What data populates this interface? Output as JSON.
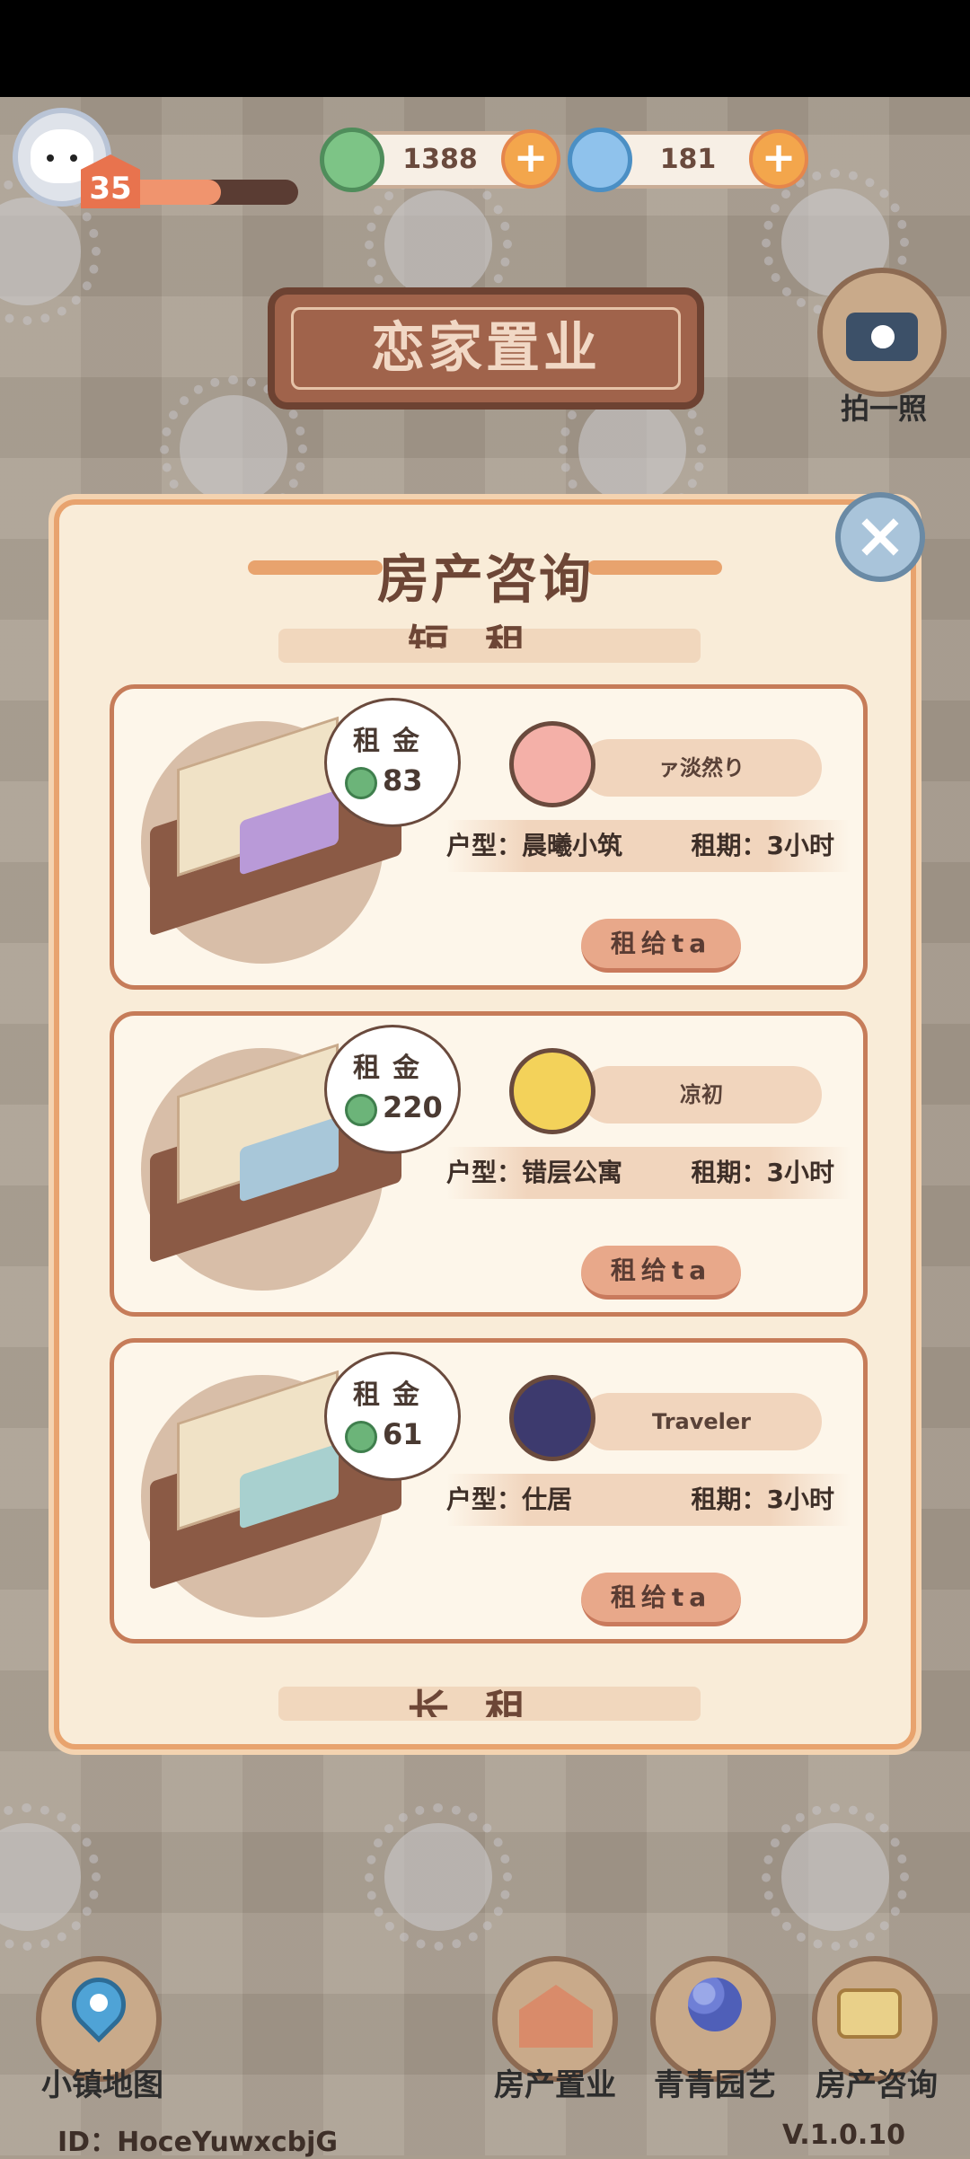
{
  "player": {
    "level": "35",
    "xp_fraction": 0.55
  },
  "currency": {
    "clover": {
      "value": "1388",
      "icon": "clover-icon"
    },
    "spiral": {
      "value": "181",
      "icon": "spiral-icon"
    }
  },
  "header": {
    "title": "恋家置业",
    "camera_label": "拍一照"
  },
  "modal": {
    "title": "房产咨询",
    "section_short": "短租",
    "section_long": "长租",
    "close": "×",
    "listings": [
      {
        "rent_label": "租金",
        "price": "83",
        "tenant": "ァ淡然り",
        "type": "户型：晨曦小筑",
        "term": "租期：3小时",
        "button": "租给ta",
        "rug_color": "#b99ad8",
        "avatar_color": "#f4b0a8"
      },
      {
        "rent_label": "租金",
        "price": "220",
        "tenant": "凉初",
        "type": "户型：错层公寓",
        "term": "租期：3小时",
        "button": "租给ta",
        "rug_color": "#a8c7d9",
        "avatar_color": "#f3d25a"
      },
      {
        "rent_label": "租金",
        "price": "61",
        "tenant": "Traveler",
        "type": "户型：仕居",
        "term": "租期：3小时",
        "button": "租给ta",
        "rug_color": "#a8d0cf",
        "avatar_color": "#3d3a6e"
      }
    ]
  },
  "nav": {
    "map": "小镇地图",
    "property": "房产置业",
    "garden": "青青园艺",
    "consult": "房产咨询"
  },
  "footer": {
    "id": "ID：HoceYuwxcbjG",
    "version": "V.1.0.10"
  }
}
